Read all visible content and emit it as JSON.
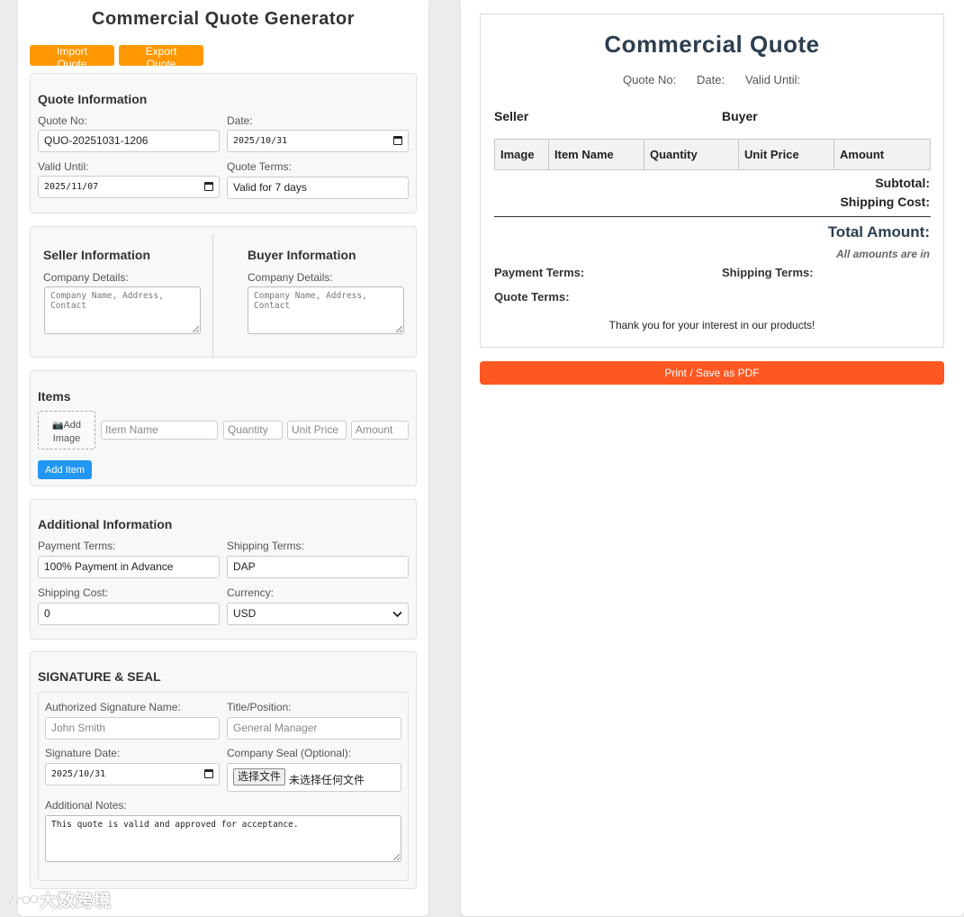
{
  "app": {
    "title": "Commercial Quote Generator",
    "import_label": "Import Quote",
    "export_label": "Export Quote"
  },
  "quote_info": {
    "title": "Quote Information",
    "quote_no_label": "Quote No:",
    "quote_no_value": "QUO-20251031-1206",
    "date_label": "Date:",
    "date_value": "2025/10/31",
    "valid_until_label": "Valid Until:",
    "valid_until_value": "2025/11/07",
    "quote_terms_label": "Quote Terms:",
    "quote_terms_value": "Valid for 7 days"
  },
  "parties": {
    "seller_title": "Seller Information",
    "buyer_title": "Buyer Information",
    "company_label": "Company Details:",
    "company_placeholder": "Company Name, Address, Contact"
  },
  "items": {
    "title": "Items",
    "add_image_icon": "camera-icon",
    "add_image_glyph": "📷",
    "add_image_label": "Add Image",
    "item_name_placeholder": "Item Name",
    "quantity_placeholder": "Quantity",
    "unit_price_placeholder": "Unit Price",
    "amount_placeholder": "Amount",
    "add_item_label": "Add Item"
  },
  "additional": {
    "title": "Additional Information",
    "payment_terms_label": "Payment Terms:",
    "payment_terms_value": "100% Payment in Advance",
    "shipping_terms_label": "Shipping Terms:",
    "shipping_terms_value": "DAP",
    "shipping_cost_label": "Shipping Cost:",
    "shipping_cost_value": "0",
    "currency_label": "Currency:",
    "currency_value": "USD"
  },
  "signature": {
    "title": "SIGNATURE & SEAL",
    "name_label": "Authorized Signature Name:",
    "name_placeholder": "John Smith",
    "position_label": "Title/Position:",
    "position_placeholder": "General Manager",
    "date_label": "Signature Date:",
    "date_value": "2025/10/31",
    "seal_label": "Company Seal (Optional):",
    "file_button_label": "选择文件",
    "file_status": "未选择任何文件",
    "notes_label": "Additional Notes:",
    "notes_value": "This quote is valid and approved for acceptance."
  },
  "watermark": "大数跨境",
  "preview": {
    "title": "Commercial Quote",
    "quote_no_label": "Quote No:",
    "date_label": "Date:",
    "valid_until_label": "Valid Until:",
    "seller_label": "Seller",
    "buyer_label": "Buyer",
    "table_headers": [
      "Image",
      "Item Name",
      "Quantity",
      "Unit Price",
      "Amount"
    ],
    "subtotal_label": "Subtotal:",
    "shipping_cost_label": "Shipping Cost:",
    "total_label": "Total Amount:",
    "currency_note": "All amounts are in",
    "payment_terms_label": "Payment Terms:",
    "shipping_terms_label": "Shipping Terms:",
    "quote_terms_label": "Quote Terms:",
    "thanks": "Thank you for your interest in our products!"
  },
  "print_label": "Print / Save as PDF",
  "colors": {
    "orange": "#ff9800",
    "blue": "#2196f3",
    "print_orange": "#ff5722",
    "preview_title": "#2c3e50"
  }
}
